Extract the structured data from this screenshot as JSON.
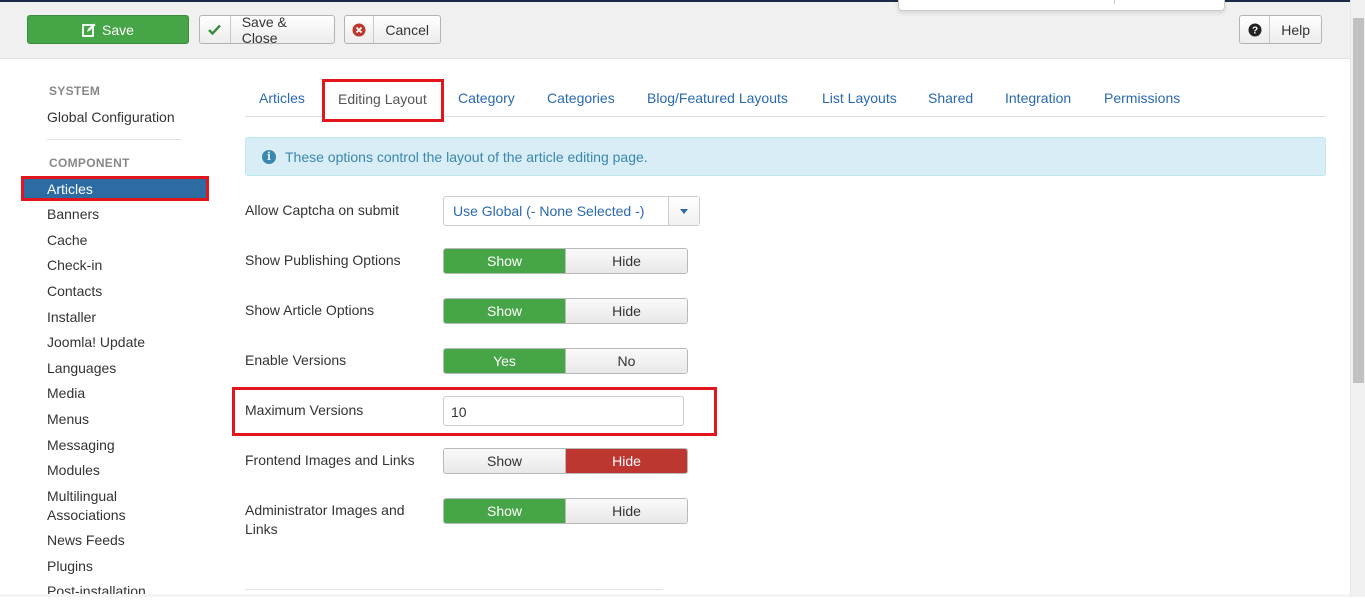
{
  "toolbar": {
    "save_label": "Save",
    "save_close_label": "Save & Close",
    "cancel_label": "Cancel",
    "help_label": "Help",
    "save_color": "#46a546"
  },
  "sidebar": {
    "system_heading": "SYSTEM",
    "global_config": "Global Configuration",
    "component_heading": "COMPONENT",
    "active_item": "Articles",
    "items": [
      "Banners",
      "Cache",
      "Check-in",
      "Contacts",
      "Installer",
      "Joomla! Update",
      "Languages",
      "Media",
      "Menus",
      "Messaging",
      "Modules",
      "Multilingual Associations",
      "News Feeds",
      "Plugins",
      "Post-installation"
    ]
  },
  "tabs": {
    "items": [
      "Articles",
      "Editing Layout",
      "Category",
      "Categories",
      "Blog/Featured Layouts",
      "List Layouts",
      "Shared",
      "Integration",
      "Permissions"
    ],
    "active": "Editing Layout"
  },
  "info": {
    "message": "These options control the layout of the article editing page."
  },
  "form": {
    "captcha": {
      "label": "Allow Captcha on submit",
      "value": "Use Global (- None Selected -)"
    },
    "publishing": {
      "label": "Show Publishing Options",
      "on": "Show",
      "off": "Hide",
      "selected": "Show"
    },
    "article_options": {
      "label": "Show Article Options",
      "on": "Show",
      "off": "Hide",
      "selected": "Show"
    },
    "versions": {
      "label": "Enable Versions",
      "on": "Yes",
      "off": "No",
      "selected": "Yes"
    },
    "max_versions": {
      "label": "Maximum Versions",
      "value": "10"
    },
    "frontend_images": {
      "label": "Frontend Images and Links",
      "on": "Show",
      "off": "Hide",
      "selected": "Hide"
    },
    "admin_images": {
      "label": "Administrator Images and Links",
      "on": "Show",
      "off": "Hide",
      "selected": "Show"
    }
  },
  "colors": {
    "accent_blue": "#2d6ca2",
    "highlight_red": "#e2141c",
    "toggle_green": "#46a546",
    "toggle_red": "#bd362f",
    "info_bg": "#d9edf7"
  }
}
